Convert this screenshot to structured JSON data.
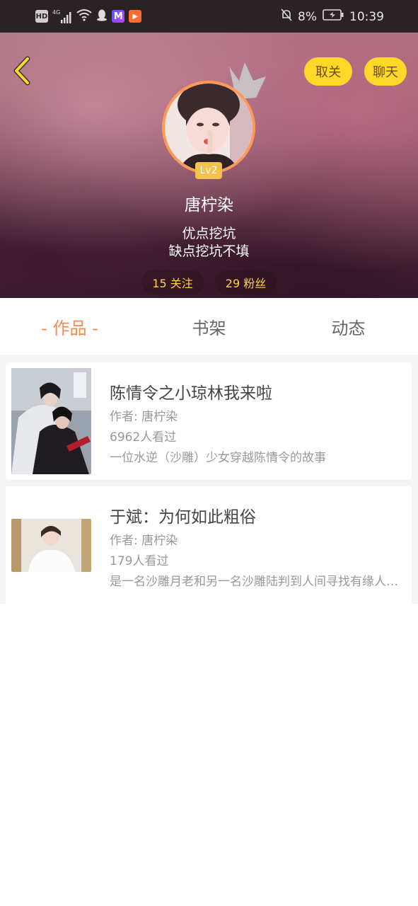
{
  "status_bar": {
    "left_icons": [
      "hd-icon",
      "signal-4g-icon",
      "wifi-icon",
      "qq-icon",
      "meitu-icon",
      "video-app-icon"
    ],
    "hd_label": "HD",
    "net_label": "4G",
    "battery_percent": "8%",
    "time": "10:39"
  },
  "header": {
    "unfollow_label": "取关",
    "chat_label": "聊天",
    "level": "Lv2",
    "username": "唐柠染",
    "bio_line1": "优点挖坑",
    "bio_line2": "缺点挖坑不填",
    "following": "15 关注",
    "fans": "29 粉丝"
  },
  "tabs": [
    {
      "label": "- 作品 -",
      "active": true
    },
    {
      "label": "书架",
      "active": false
    },
    {
      "label": "动态",
      "active": false
    }
  ],
  "works": [
    {
      "title": "陈情令之小琼林我来啦",
      "author": "作者: 唐柠染",
      "views": "6962人看过",
      "desc": "一位水逆（沙雕）少女穿越陈情令的故事"
    },
    {
      "title": "于斌：为何如此粗俗",
      "author": "作者: 唐柠染",
      "views": "179人看过",
      "desc": "是一名沙雕月老和另一名沙雕陆判到人间寻找有缘人的故事"
    }
  ],
  "colors": {
    "accent": "#f28a54",
    "button_yellow": "#ffd82a",
    "stat_text": "#ffd24a"
  }
}
